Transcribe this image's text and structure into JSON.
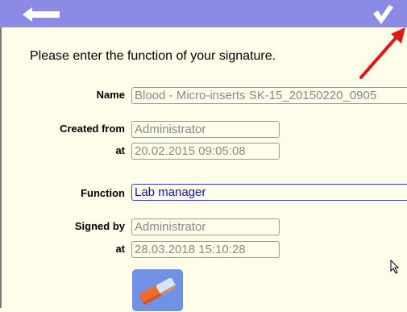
{
  "toolbar": {
    "back_icon": "back-arrow-icon",
    "confirm_icon": "checkmark-icon",
    "bar_color": "#8b8be6"
  },
  "form": {
    "instruction": "Please enter the function of your signature.",
    "name": {
      "label": "Name",
      "value": "Blood - Micro-inserts SK-15_20150220_0905"
    },
    "created_from": {
      "label": "Created from",
      "value": "Administrator"
    },
    "created_at": {
      "label": "at",
      "value": "20.02.2015  09:05:08"
    },
    "function": {
      "label": "Function",
      "value": "Lab manager"
    },
    "signed_by": {
      "label": "Signed by",
      "value": "Administrator"
    },
    "signed_at": {
      "label": "at",
      "value": "28.03.2018  15:10:28"
    },
    "clear_icon": "eraser-icon"
  },
  "overlay": {
    "annotation_arrow_color": "#e01818",
    "cursor_icon": "mouse-pointer-icon"
  }
}
